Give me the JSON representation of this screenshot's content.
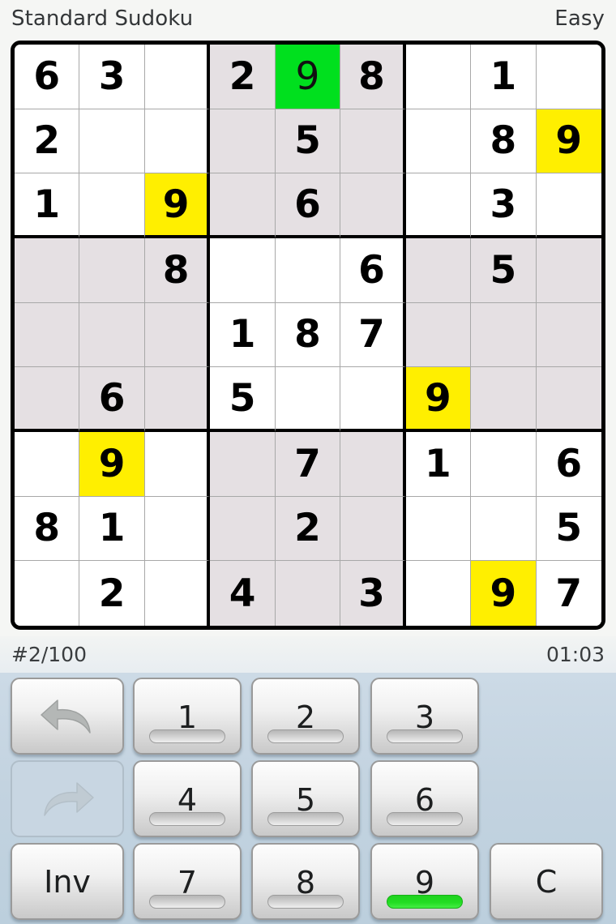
{
  "header": {
    "title": "Standard Sudoku",
    "difficulty": "Easy"
  },
  "status": {
    "puzzle_index": "#2/100",
    "timer": "01:03"
  },
  "board": {
    "size": 9,
    "cells": [
      [
        {
          "v": "6",
          "s": "normal"
        },
        {
          "v": "3",
          "s": "normal"
        },
        {
          "v": "",
          "s": "normal"
        },
        {
          "v": "2",
          "s": "hl"
        },
        {
          "v": "9",
          "s": "green"
        },
        {
          "v": "8",
          "s": "hl"
        },
        {
          "v": "",
          "s": "normal"
        },
        {
          "v": "1",
          "s": "normal"
        },
        {
          "v": "",
          "s": "normal"
        }
      ],
      [
        {
          "v": "2",
          "s": "normal"
        },
        {
          "v": "",
          "s": "normal"
        },
        {
          "v": "",
          "s": "normal"
        },
        {
          "v": "",
          "s": "hl"
        },
        {
          "v": "5",
          "s": "hl"
        },
        {
          "v": "",
          "s": "hl"
        },
        {
          "v": "",
          "s": "normal"
        },
        {
          "v": "8",
          "s": "normal"
        },
        {
          "v": "9",
          "s": "yellow"
        }
      ],
      [
        {
          "v": "1",
          "s": "normal"
        },
        {
          "v": "",
          "s": "normal"
        },
        {
          "v": "9",
          "s": "yellow"
        },
        {
          "v": "",
          "s": "hl"
        },
        {
          "v": "6",
          "s": "hl"
        },
        {
          "v": "",
          "s": "hl"
        },
        {
          "v": "",
          "s": "normal"
        },
        {
          "v": "3",
          "s": "normal"
        },
        {
          "v": "",
          "s": "normal"
        }
      ],
      [
        {
          "v": "",
          "s": "hl"
        },
        {
          "v": "",
          "s": "hl"
        },
        {
          "v": "8",
          "s": "hl"
        },
        {
          "v": "",
          "s": "normal"
        },
        {
          "v": "",
          "s": "normal"
        },
        {
          "v": "6",
          "s": "normal"
        },
        {
          "v": "",
          "s": "hl"
        },
        {
          "v": "5",
          "s": "hl"
        },
        {
          "v": "",
          "s": "hl"
        }
      ],
      [
        {
          "v": "",
          "s": "hl"
        },
        {
          "v": "",
          "s": "hl"
        },
        {
          "v": "",
          "s": "hl"
        },
        {
          "v": "1",
          "s": "normal"
        },
        {
          "v": "8",
          "s": "normal"
        },
        {
          "v": "7",
          "s": "normal"
        },
        {
          "v": "",
          "s": "hl"
        },
        {
          "v": "",
          "s": "hl"
        },
        {
          "v": "",
          "s": "hl"
        }
      ],
      [
        {
          "v": "",
          "s": "hl"
        },
        {
          "v": "6",
          "s": "hl"
        },
        {
          "v": "",
          "s": "hl"
        },
        {
          "v": "5",
          "s": "normal"
        },
        {
          "v": "",
          "s": "normal"
        },
        {
          "v": "",
          "s": "normal"
        },
        {
          "v": "9",
          "s": "yellow"
        },
        {
          "v": "",
          "s": "hl"
        },
        {
          "v": "",
          "s": "hl"
        }
      ],
      [
        {
          "v": "",
          "s": "normal"
        },
        {
          "v": "9",
          "s": "yellow"
        },
        {
          "v": "",
          "s": "normal"
        },
        {
          "v": "",
          "s": "hl"
        },
        {
          "v": "7",
          "s": "hl"
        },
        {
          "v": "",
          "s": "hl"
        },
        {
          "v": "1",
          "s": "normal"
        },
        {
          "v": "",
          "s": "normal"
        },
        {
          "v": "6",
          "s": "normal"
        }
      ],
      [
        {
          "v": "8",
          "s": "normal"
        },
        {
          "v": "1",
          "s": "normal"
        },
        {
          "v": "",
          "s": "normal"
        },
        {
          "v": "",
          "s": "hl"
        },
        {
          "v": "2",
          "s": "hl"
        },
        {
          "v": "",
          "s": "hl"
        },
        {
          "v": "",
          "s": "normal"
        },
        {
          "v": "",
          "s": "normal"
        },
        {
          "v": "5",
          "s": "normal"
        }
      ],
      [
        {
          "v": "",
          "s": "normal"
        },
        {
          "v": "2",
          "s": "normal"
        },
        {
          "v": "",
          "s": "normal"
        },
        {
          "v": "4",
          "s": "hl"
        },
        {
          "v": "",
          "s": "hl"
        },
        {
          "v": "3",
          "s": "hl"
        },
        {
          "v": "",
          "s": "normal"
        },
        {
          "v": "9",
          "s": "yellow"
        },
        {
          "v": "7",
          "s": "normal"
        }
      ]
    ]
  },
  "keypad": {
    "undo_label": "undo-arrow-icon",
    "redo_label": "redo-arrow-icon",
    "redo_disabled": true,
    "inv_label": "Inv",
    "clear_label": "C",
    "digits": [
      {
        "label": "1",
        "complete": false
      },
      {
        "label": "2",
        "complete": false
      },
      {
        "label": "3",
        "complete": false
      },
      {
        "label": "4",
        "complete": false
      },
      {
        "label": "5",
        "complete": false
      },
      {
        "label": "6",
        "complete": false
      },
      {
        "label": "7",
        "complete": false
      },
      {
        "label": "8",
        "complete": false
      },
      {
        "label": "9",
        "complete": true
      }
    ]
  },
  "colors": {
    "highlight": "#e5e0e3",
    "yellow": "#ffef00",
    "green": "#00e01e",
    "keypad_bg": "#c5d4e0"
  }
}
